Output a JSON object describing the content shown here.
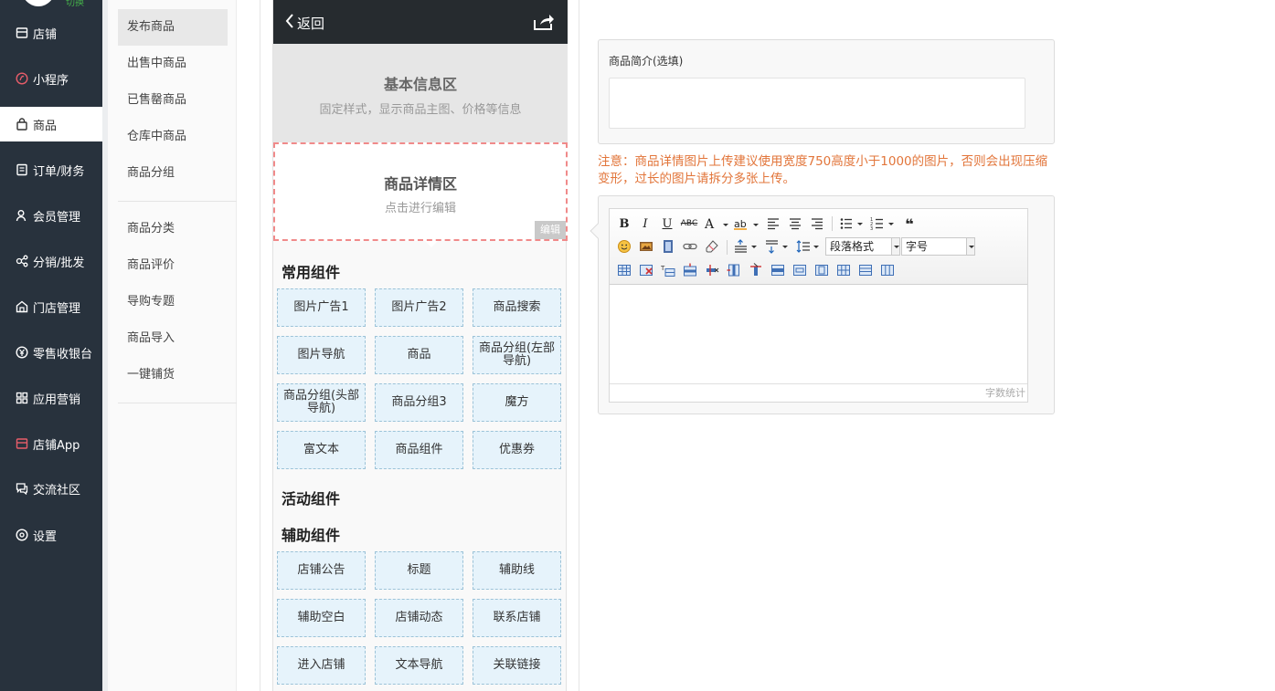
{
  "nav": {
    "logo_tag": "切换",
    "items": [
      {
        "label": "店铺",
        "icon": "store-icon"
      },
      {
        "label": "小程序",
        "icon": "miniprogram-icon"
      },
      {
        "label": "商品",
        "icon": "bag-icon"
      },
      {
        "label": "订单/财务",
        "icon": "order-icon"
      },
      {
        "label": "会员管理",
        "icon": "member-icon"
      },
      {
        "label": "分销/批发",
        "icon": "distribution-icon"
      },
      {
        "label": "门店管理",
        "icon": "shop-icon"
      },
      {
        "label": "零售收银台",
        "icon": "cashier-icon"
      },
      {
        "label": "应用营销",
        "icon": "apps-icon"
      },
      {
        "label": "店铺App",
        "icon": "app-icon"
      },
      {
        "label": "交流社区",
        "icon": "community-icon"
      },
      {
        "label": "设置",
        "icon": "settings-icon"
      }
    ],
    "active_index": 2,
    "accent": "#e85d6a"
  },
  "subnav": {
    "group1": [
      "发布商品",
      "出售中商品",
      "已售罄商品",
      "仓库中商品",
      "商品分组"
    ],
    "group2": [
      "商品分类",
      "商品评价",
      "导购专题",
      "商品导入",
      "一键铺货"
    ]
  },
  "phone": {
    "back_label": "返回",
    "basic_title": "基本信息区",
    "basic_sub": "固定样式，显示商品主图、价格等信息",
    "detail_title": "商品详情区",
    "detail_sub": "点击进行编辑",
    "edit_badge": "编辑",
    "sections": {
      "common": "常用组件",
      "activity": "活动组件",
      "aux": "辅助组件"
    },
    "common_components": [
      "图片广告1",
      "图片广告2",
      "商品搜索",
      "图片导航",
      "商品",
      "商品分组(左部导航)",
      "商品分组(头部导航)",
      "商品分组3",
      "魔方",
      "富文本",
      "商品组件",
      "优惠券"
    ],
    "aux_components": [
      "店铺公告",
      "标题",
      "辅助线",
      "辅助空白",
      "店铺动态",
      "联系店铺",
      "进入店铺",
      "文本导航",
      "关联链接"
    ]
  },
  "form": {
    "intro_label": "商品简介(选填)",
    "intro_value": "",
    "note": "注意：商品详情图片上传建议使用宽度750高度小于1000的图片，否则会出现压缩变形，过长的图片请拆分多张上传。",
    "note_color": "#e2753a",
    "editor": {
      "paragraph_select": "段落格式",
      "fontsize_select": "字号",
      "counter": "字数统计"
    }
  }
}
